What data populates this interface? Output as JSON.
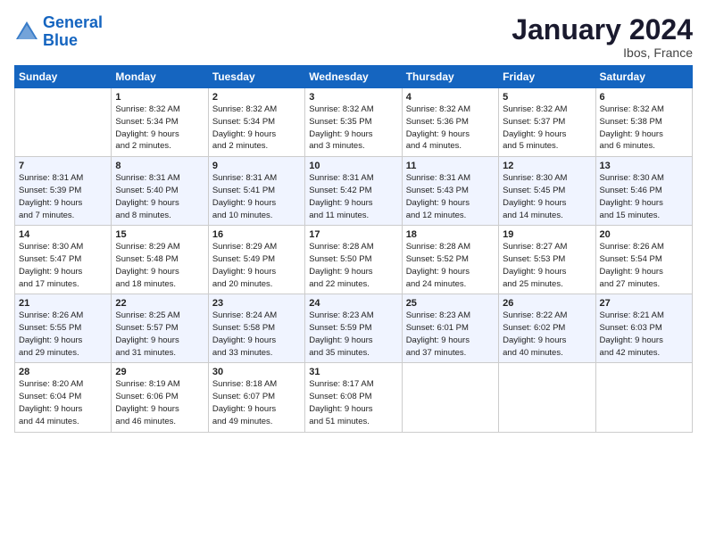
{
  "logo": {
    "line1": "General",
    "line2": "Blue"
  },
  "title": "January 2024",
  "location": "Ibos, France",
  "days_header": [
    "Sunday",
    "Monday",
    "Tuesday",
    "Wednesday",
    "Thursday",
    "Friday",
    "Saturday"
  ],
  "weeks": [
    [
      {
        "num": "",
        "lines": []
      },
      {
        "num": "1",
        "lines": [
          "Sunrise: 8:32 AM",
          "Sunset: 5:34 PM",
          "Daylight: 9 hours",
          "and 2 minutes."
        ]
      },
      {
        "num": "2",
        "lines": [
          "Sunrise: 8:32 AM",
          "Sunset: 5:34 PM",
          "Daylight: 9 hours",
          "and 2 minutes."
        ]
      },
      {
        "num": "3",
        "lines": [
          "Sunrise: 8:32 AM",
          "Sunset: 5:35 PM",
          "Daylight: 9 hours",
          "and 3 minutes."
        ]
      },
      {
        "num": "4",
        "lines": [
          "Sunrise: 8:32 AM",
          "Sunset: 5:36 PM",
          "Daylight: 9 hours",
          "and 4 minutes."
        ]
      },
      {
        "num": "5",
        "lines": [
          "Sunrise: 8:32 AM",
          "Sunset: 5:37 PM",
          "Daylight: 9 hours",
          "and 5 minutes."
        ]
      },
      {
        "num": "6",
        "lines": [
          "Sunrise: 8:32 AM",
          "Sunset: 5:38 PM",
          "Daylight: 9 hours",
          "and 6 minutes."
        ]
      }
    ],
    [
      {
        "num": "7",
        "lines": [
          "Sunrise: 8:31 AM",
          "Sunset: 5:39 PM",
          "Daylight: 9 hours",
          "and 7 minutes."
        ]
      },
      {
        "num": "8",
        "lines": [
          "Sunrise: 8:31 AM",
          "Sunset: 5:40 PM",
          "Daylight: 9 hours",
          "and 8 minutes."
        ]
      },
      {
        "num": "9",
        "lines": [
          "Sunrise: 8:31 AM",
          "Sunset: 5:41 PM",
          "Daylight: 9 hours",
          "and 10 minutes."
        ]
      },
      {
        "num": "10",
        "lines": [
          "Sunrise: 8:31 AM",
          "Sunset: 5:42 PM",
          "Daylight: 9 hours",
          "and 11 minutes."
        ]
      },
      {
        "num": "11",
        "lines": [
          "Sunrise: 8:31 AM",
          "Sunset: 5:43 PM",
          "Daylight: 9 hours",
          "and 12 minutes."
        ]
      },
      {
        "num": "12",
        "lines": [
          "Sunrise: 8:30 AM",
          "Sunset: 5:45 PM",
          "Daylight: 9 hours",
          "and 14 minutes."
        ]
      },
      {
        "num": "13",
        "lines": [
          "Sunrise: 8:30 AM",
          "Sunset: 5:46 PM",
          "Daylight: 9 hours",
          "and 15 minutes."
        ]
      }
    ],
    [
      {
        "num": "14",
        "lines": [
          "Sunrise: 8:30 AM",
          "Sunset: 5:47 PM",
          "Daylight: 9 hours",
          "and 17 minutes."
        ]
      },
      {
        "num": "15",
        "lines": [
          "Sunrise: 8:29 AM",
          "Sunset: 5:48 PM",
          "Daylight: 9 hours",
          "and 18 minutes."
        ]
      },
      {
        "num": "16",
        "lines": [
          "Sunrise: 8:29 AM",
          "Sunset: 5:49 PM",
          "Daylight: 9 hours",
          "and 20 minutes."
        ]
      },
      {
        "num": "17",
        "lines": [
          "Sunrise: 8:28 AM",
          "Sunset: 5:50 PM",
          "Daylight: 9 hours",
          "and 22 minutes."
        ]
      },
      {
        "num": "18",
        "lines": [
          "Sunrise: 8:28 AM",
          "Sunset: 5:52 PM",
          "Daylight: 9 hours",
          "and 24 minutes."
        ]
      },
      {
        "num": "19",
        "lines": [
          "Sunrise: 8:27 AM",
          "Sunset: 5:53 PM",
          "Daylight: 9 hours",
          "and 25 minutes."
        ]
      },
      {
        "num": "20",
        "lines": [
          "Sunrise: 8:26 AM",
          "Sunset: 5:54 PM",
          "Daylight: 9 hours",
          "and 27 minutes."
        ]
      }
    ],
    [
      {
        "num": "21",
        "lines": [
          "Sunrise: 8:26 AM",
          "Sunset: 5:55 PM",
          "Daylight: 9 hours",
          "and 29 minutes."
        ]
      },
      {
        "num": "22",
        "lines": [
          "Sunrise: 8:25 AM",
          "Sunset: 5:57 PM",
          "Daylight: 9 hours",
          "and 31 minutes."
        ]
      },
      {
        "num": "23",
        "lines": [
          "Sunrise: 8:24 AM",
          "Sunset: 5:58 PM",
          "Daylight: 9 hours",
          "and 33 minutes."
        ]
      },
      {
        "num": "24",
        "lines": [
          "Sunrise: 8:23 AM",
          "Sunset: 5:59 PM",
          "Daylight: 9 hours",
          "and 35 minutes."
        ]
      },
      {
        "num": "25",
        "lines": [
          "Sunrise: 8:23 AM",
          "Sunset: 6:01 PM",
          "Daylight: 9 hours",
          "and 37 minutes."
        ]
      },
      {
        "num": "26",
        "lines": [
          "Sunrise: 8:22 AM",
          "Sunset: 6:02 PM",
          "Daylight: 9 hours",
          "and 40 minutes."
        ]
      },
      {
        "num": "27",
        "lines": [
          "Sunrise: 8:21 AM",
          "Sunset: 6:03 PM",
          "Daylight: 9 hours",
          "and 42 minutes."
        ]
      }
    ],
    [
      {
        "num": "28",
        "lines": [
          "Sunrise: 8:20 AM",
          "Sunset: 6:04 PM",
          "Daylight: 9 hours",
          "and 44 minutes."
        ]
      },
      {
        "num": "29",
        "lines": [
          "Sunrise: 8:19 AM",
          "Sunset: 6:06 PM",
          "Daylight: 9 hours",
          "and 46 minutes."
        ]
      },
      {
        "num": "30",
        "lines": [
          "Sunrise: 8:18 AM",
          "Sunset: 6:07 PM",
          "Daylight: 9 hours",
          "and 49 minutes."
        ]
      },
      {
        "num": "31",
        "lines": [
          "Sunrise: 8:17 AM",
          "Sunset: 6:08 PM",
          "Daylight: 9 hours",
          "and 51 minutes."
        ]
      },
      {
        "num": "",
        "lines": []
      },
      {
        "num": "",
        "lines": []
      },
      {
        "num": "",
        "lines": []
      }
    ]
  ]
}
